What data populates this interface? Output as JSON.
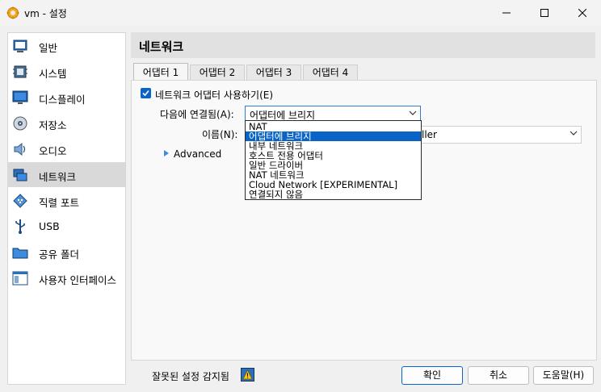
{
  "window": {
    "title": "vm - 설정",
    "controls": [
      "minimize",
      "maximize",
      "close"
    ]
  },
  "sidebar": {
    "items": [
      {
        "label": "일반",
        "icon": "general-icon"
      },
      {
        "label": "시스템",
        "icon": "system-icon"
      },
      {
        "label": "디스플레이",
        "icon": "display-icon"
      },
      {
        "label": "저장소",
        "icon": "storage-icon"
      },
      {
        "label": "오디오",
        "icon": "audio-icon"
      },
      {
        "label": "네트워크",
        "icon": "network-icon",
        "selected": true
      },
      {
        "label": "직렬 포트",
        "icon": "serial-port-icon"
      },
      {
        "label": "USB",
        "icon": "usb-icon"
      },
      {
        "label": "공유 폴더",
        "icon": "shared-folder-icon"
      },
      {
        "label": "사용자 인터페이스",
        "icon": "user-interface-icon"
      }
    ]
  },
  "page": {
    "title": "네트워크",
    "tabs": [
      {
        "label": "어댑터 1",
        "active": true
      },
      {
        "label": "어댑터 2"
      },
      {
        "label": "어댑터 3"
      },
      {
        "label": "어댑터 4"
      }
    ]
  },
  "adapter": {
    "enable_label": "네트워크 어댑터 사용하기(E)",
    "enabled": true,
    "attached_label": "다음에 연결됨(A):",
    "attached_value": "어댑터에 브리지",
    "name_label": "이름(N):",
    "name_value_partial": "ller",
    "advanced_label": "Advanced"
  },
  "dropdown": {
    "options": [
      "NAT",
      "어댑터에 브리지",
      "내부 네트워크",
      "호스트 전용 어댑터",
      "일반 드라이버",
      "NAT 네트워크",
      "Cloud Network [EXPERIMENTAL]",
      "연결되지 않음"
    ],
    "selected_index": 1
  },
  "footer": {
    "warning_text": "잘못된 설정 감지됨",
    "ok_label": "확인",
    "cancel_label": "취소",
    "help_label": "도움말(H)"
  },
  "colors": {
    "accent": "#0a64c8",
    "selected_row": "#d9d9d9"
  }
}
